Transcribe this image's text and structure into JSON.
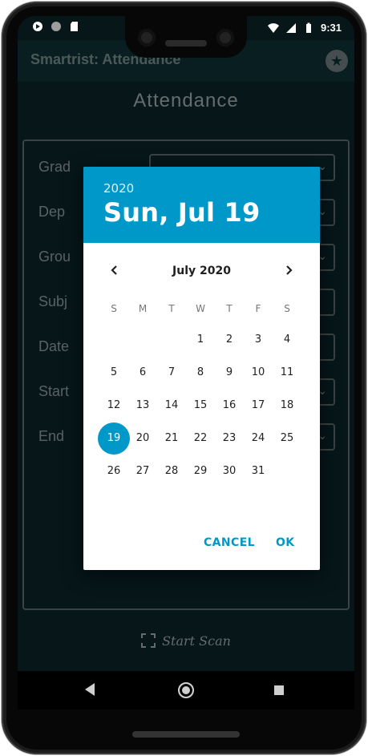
{
  "status_bar": {
    "time": "9:31",
    "left_icons": [
      "play-store-icon",
      "circle-icon",
      "sd-card-icon"
    ],
    "right_icons": [
      "wifi-icon",
      "signal-icon",
      "battery-icon"
    ]
  },
  "app_bar": {
    "title": "Smartrist: Attendance",
    "action_icon": "star-icon"
  },
  "page": {
    "title": "Attendance",
    "fields": [
      {
        "label": "Grad",
        "type": "dropdown"
      },
      {
        "label": "Dep",
        "type": "dropdown"
      },
      {
        "label": "Grou",
        "type": "dropdown"
      },
      {
        "label": "Subj",
        "type": "text"
      },
      {
        "label": "Date",
        "type": "text"
      },
      {
        "label": "Start",
        "type": "dropdown"
      },
      {
        "label": "End",
        "type": "dropdown"
      }
    ],
    "scan_button": "Start Scan"
  },
  "date_picker": {
    "year": "2020",
    "selected_date": "Sun, Jul 19",
    "month_label": "July 2020",
    "weekdays": [
      "S",
      "M",
      "T",
      "W",
      "T",
      "F",
      "S"
    ],
    "first_weekday_index": 3,
    "days_in_month": 31,
    "selected_day": 19,
    "cancel_label": "CANCEL",
    "ok_label": "OK",
    "accent_color": "#0098c8"
  },
  "nav_bar": {
    "buttons": [
      "back-icon",
      "home-icon",
      "recents-icon"
    ]
  }
}
